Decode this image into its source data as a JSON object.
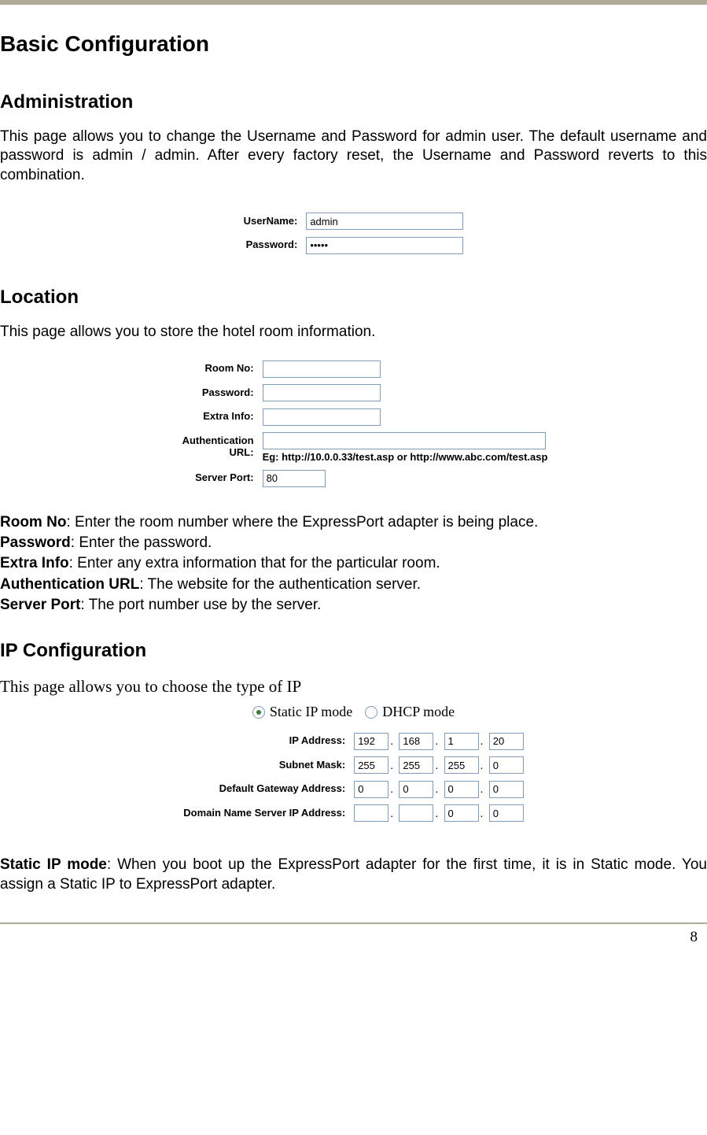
{
  "page_number": "8",
  "title": "Basic Configuration",
  "admin": {
    "heading": "Administration",
    "para": "This page allows you to change the Username and Password for admin user. The default username and password is admin / admin. After every factory reset, the Username and Password reverts to this combination.",
    "username_label": "UserName:",
    "username_value": "admin",
    "password_label": "Password:",
    "password_value": "•••••"
  },
  "location": {
    "heading": "Location",
    "para": "This page allows you to store the hotel room information.",
    "room_label": "Room No:",
    "room_value": "",
    "pwd_label": "Password:",
    "pwd_value": "",
    "extra_label": "Extra Info:",
    "extra_value": "",
    "auth_label": "Authentication URL:",
    "auth_value": "",
    "auth_hint": "Eg: http://10.0.0.33/test.asp or http://www.abc.com/test.asp",
    "port_label": "Server Port:",
    "port_value": "80",
    "desc": {
      "room_k": "Room No",
      "room_v": ": Enter the room number where the ExpressPort adapter is being place.",
      "pwd_k": "Password",
      "pwd_v": ": Enter the password.",
      "extra_k": "Extra Info",
      "extra_v": ": Enter any extra information that for the particular room.",
      "auth_k": "Authentication URL",
      "auth_v": ": The website for the authentication server.",
      "port_k": "Server Port",
      "port_v": ": The port number use by the server."
    }
  },
  "ip": {
    "heading": "IP Configuration",
    "para": "This page allows you to choose the type of IP",
    "radio_static": "Static IP mode",
    "radio_dhcp": "DHCP mode",
    "rows": {
      "ip_label": "IP Address:",
      "ip_o": [
        "192",
        "168",
        "1",
        "20"
      ],
      "mask_label": "Subnet Mask:",
      "mask_o": [
        "255",
        "255",
        "255",
        "0"
      ],
      "gw_label": "Default Gateway Address:",
      "gw_o": [
        "0",
        "0",
        "0",
        "0"
      ],
      "dns_label": "Domain Name Server IP Address:",
      "dns_o": [
        "",
        "",
        "0",
        "0"
      ]
    },
    "desc_k": "Static IP mode",
    "desc_v": ": When you boot up the ExpressPort adapter for the first time, it is in Static mode. You assign a Static IP to ExpressPort adapter."
  }
}
